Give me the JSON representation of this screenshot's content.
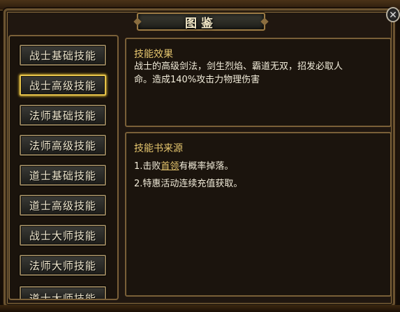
{
  "window": {
    "title": "图鉴",
    "close_label": "✕"
  },
  "skill_tabs": [
    {
      "label": "战士基础技能",
      "active": false
    },
    {
      "label": "战士高级技能",
      "active": true
    },
    {
      "label": "法师基础技能",
      "active": false
    },
    {
      "label": "法师高级技能",
      "active": false
    },
    {
      "label": "道士基础技能",
      "active": false
    },
    {
      "label": "道士高级技能",
      "active": false
    },
    {
      "label": "战士大师技能",
      "active": false
    },
    {
      "label": "法师大师技能",
      "active": false
    },
    {
      "label": "道士大师技能",
      "active": false
    }
  ],
  "effect": {
    "heading": "技能效果",
    "line1": "战士的高级剑法，剑生烈焰、霸道无双，招发必取人",
    "line2": "命。造成140%攻击力物理伤害"
  },
  "source": {
    "heading": "技能书来源",
    "item1_prefix": "1.击败",
    "item1_link": "首领",
    "item1_suffix": "有概率掉落。",
    "item2": "2.特惠活动连续充值获取。"
  },
  "colors": {
    "accent_gold": "#e6c66e",
    "active_border": "#e6c34a",
    "text": "#f2ecda"
  }
}
